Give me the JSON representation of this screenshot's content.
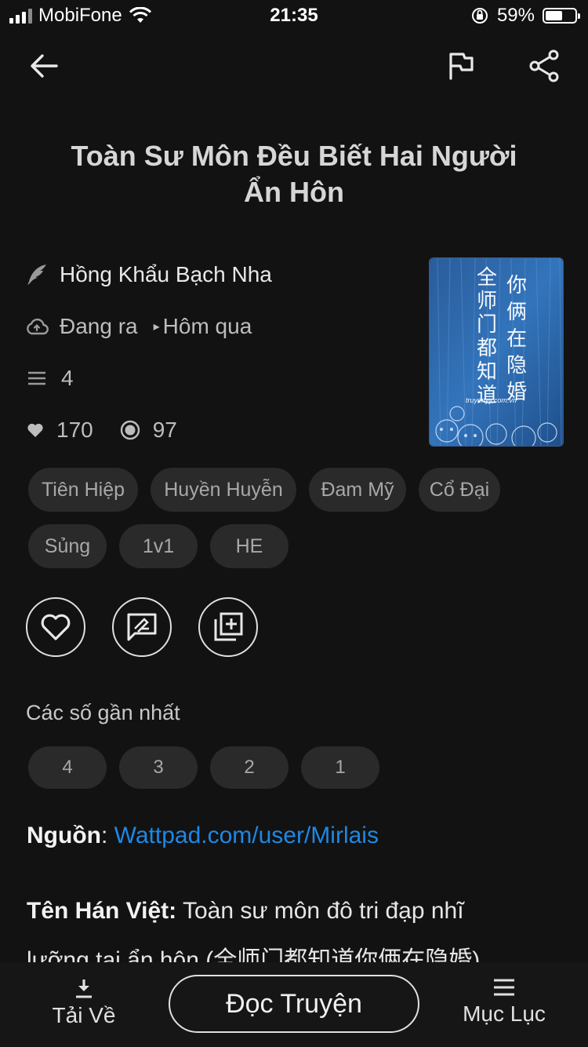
{
  "status_bar": {
    "carrier": "MobiFone",
    "time": "21:35",
    "battery": "59%",
    "battery_level": 0.59
  },
  "header": {
    "back_icon": "arrow-left-icon",
    "flag_icon": "flag-icon",
    "share_icon": "share-icon"
  },
  "book": {
    "title_line1": "Toàn Sư Môn Đều Biết Hai Người",
    "title_line2": "Ẩn Hôn",
    "author": "Hồng Khẩu Bạch Nha",
    "status": "Đang ra",
    "updated": "Hôm qua",
    "chapters": "4",
    "likes": "170",
    "views": "97",
    "cover": {
      "col_left": "全师门都知道",
      "col_right": "你俩在隐婚",
      "site": "truyenyy.com.vn"
    },
    "tags": [
      "Tiên Hiệp",
      "Huyền Huyễn",
      "Đam Mỹ",
      "Cổ Đại",
      "Sủng",
      "1v1",
      "HE"
    ]
  },
  "actions": {
    "like_icon": "heart-icon",
    "comment_icon": "comment-icon",
    "add_icon": "add-to-library-icon"
  },
  "recent": {
    "label": "Các số gần nhất",
    "chapters": [
      "4",
      "3",
      "2",
      "1"
    ]
  },
  "description": {
    "source_label": "Nguồn",
    "source_sep": ":",
    "source_value": "Wattpad.com/user/Mirlais",
    "han_viet_label": "Tên Hán Việt:",
    "han_viet_value": "Toàn sư môn đô tri đạp nhĩ",
    "han_viet_line2": "lưỡng tai ẩn hôn (全师门都知道你俩在隐婚)"
  },
  "bottom_bar": {
    "download_label": "Tải Về",
    "read_label": "Đọc Truyện",
    "toc_label": "Mục Lục"
  },
  "colors": {
    "background": "#121212",
    "chip": "#2a2a2a",
    "link": "#1e88e5"
  }
}
